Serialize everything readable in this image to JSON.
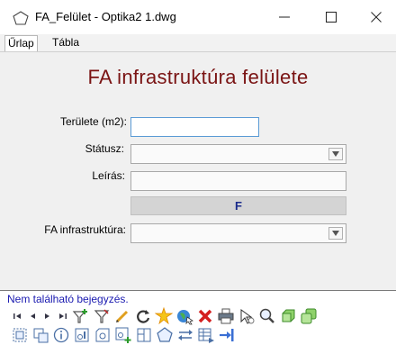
{
  "window": {
    "title": "FA_Felület - Optika2 1.dwg",
    "minimize_symbol": "—",
    "maximize_symbol": "☐",
    "close_symbol": "✕"
  },
  "tabs": [
    {
      "label": "Űrlap",
      "active": true
    },
    {
      "label": "Tábla",
      "active": false
    }
  ],
  "form": {
    "heading": "FA infrastruktúra felülete",
    "fields": {
      "terulete_label": "Területe (m2):",
      "terulete_value": "",
      "statusz_label": "Státusz:",
      "statusz_value": "",
      "leiras_label": "Leírás:",
      "leiras_value": "",
      "f_button_label": "F",
      "fa_infra_label": "FA infrastruktúra:",
      "fa_infra_value": ""
    }
  },
  "status_bar": {
    "message": "Nem található bejegyzés."
  },
  "colors": {
    "heading": "#7a1414",
    "status_text": "#1a1ab0",
    "form_background": "#f0f0f0",
    "focus_border": "#5b9bd5",
    "f_button_text": "#1b2c8c"
  },
  "toolbar_row1_icons": [
    "first-record-icon",
    "previous-record-icon",
    "next-record-icon",
    "last-record-icon",
    "filter-add-icon",
    "filter-icon",
    "edit-pencil-icon",
    "refresh-icon",
    "highlight-star-icon",
    "select-globe-icon",
    "delete-x-icon",
    "print-icon",
    "select-pointer-icon",
    "zoom-icon",
    "layer-green-icon",
    "layer-copy-green-icon"
  ],
  "toolbar_row2_icons": [
    "select-frame-icon",
    "copy-shapes-icon",
    "info-icon",
    "object-data-icon",
    "object-card-icon",
    "add-object-icon",
    "object-layout-icon",
    "polygon-icon",
    "transfer-icon",
    "table-edit-icon",
    "exit-arrow-icon"
  ]
}
